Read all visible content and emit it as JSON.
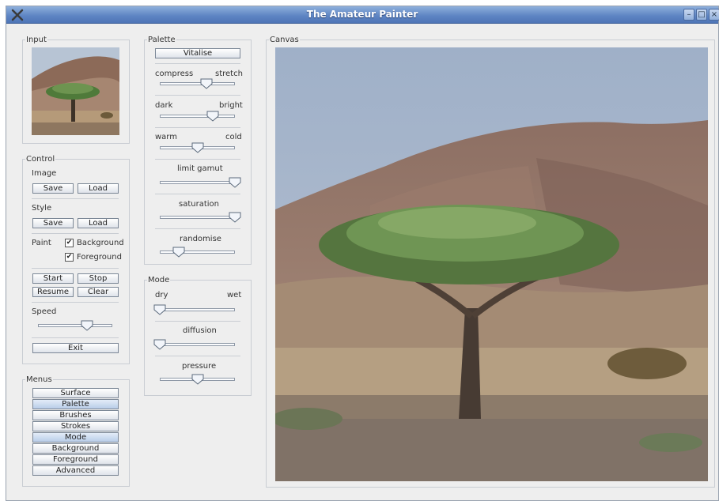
{
  "window": {
    "title": "The Amateur Painter"
  },
  "input": {
    "legend": "Input"
  },
  "control": {
    "legend": "Control",
    "image_label": "Image",
    "image_save": "Save",
    "image_load": "Load",
    "style_label": "Style",
    "style_save": "Save",
    "style_load": "Load",
    "paint_label": "Paint",
    "background_label": "Background",
    "background_checked": true,
    "foreground_label": "Foreground",
    "foreground_checked": true,
    "start": "Start",
    "stop": "Stop",
    "resume": "Resume",
    "clear": "Clear",
    "speed_label": "Speed",
    "speed_value": 0.66,
    "exit": "Exit"
  },
  "menus": {
    "legend": "Menus",
    "items": [
      {
        "label": "Surface",
        "selected": false
      },
      {
        "label": "Palette",
        "selected": true
      },
      {
        "label": "Brushes",
        "selected": false
      },
      {
        "label": "Strokes",
        "selected": false
      },
      {
        "label": "Mode",
        "selected": true
      },
      {
        "label": "Background",
        "selected": false
      },
      {
        "label": "Foreground",
        "selected": false
      },
      {
        "label": "Advanced",
        "selected": false
      }
    ]
  },
  "palette": {
    "legend": "Palette",
    "vitalise": "Vitalise",
    "compress": "compress",
    "stretch": "stretch",
    "compress_value": 0.62,
    "dark": "dark",
    "bright": "bright",
    "bright_value": 0.71,
    "warm": "warm",
    "cold": "cold",
    "warm_value": 0.51,
    "limit_gamut": "limit gamut",
    "limit_gamut_value": 1.0,
    "saturation": "saturation",
    "saturation_value": 1.0,
    "randomise": "randomise",
    "randomise_value": 0.25
  },
  "mode": {
    "legend": "Mode",
    "dry": "dry",
    "wet": "wet",
    "wet_value": 0.0,
    "diffusion": "diffusion",
    "diffusion_value": 0.0,
    "pressure": "pressure",
    "pressure_value": 0.51
  },
  "canvas": {
    "legend": "Canvas"
  },
  "colors": {
    "title_bar": "#5f86c4",
    "selected_menu": "#b9cde8",
    "window_bg": "#eeeeee"
  }
}
